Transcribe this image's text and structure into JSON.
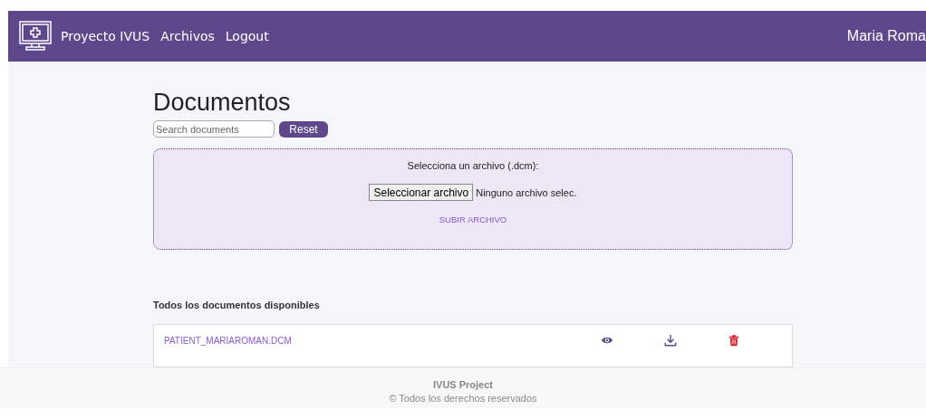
{
  "navbar": {
    "brand": "Proyecto IVUS",
    "links": [
      "Archivos",
      "Logout"
    ],
    "user": "Maria Roma"
  },
  "page": {
    "title": "Documentos",
    "search": {
      "placeholder": "Search documents"
    },
    "reset_button": "Reset"
  },
  "upload": {
    "prompt": "Selecciona un archivo (.dcm):",
    "file_button": "Seleccionar archivo",
    "file_status": "Ninguno archivo selec.",
    "submit": "SUBIR ARCHIVO"
  },
  "documents": {
    "heading": "Todos los documentos disponibles",
    "rows": [
      {
        "name": "PATIENT_MARIAROMAN.DCM",
        "actions": [
          {
            "kind": "view"
          },
          {
            "kind": "download"
          },
          {
            "kind": "delete"
          }
        ]
      }
    ]
  },
  "footer": {
    "title": "IVUS Project",
    "copyright": "© Todos los derechos reservados"
  }
}
